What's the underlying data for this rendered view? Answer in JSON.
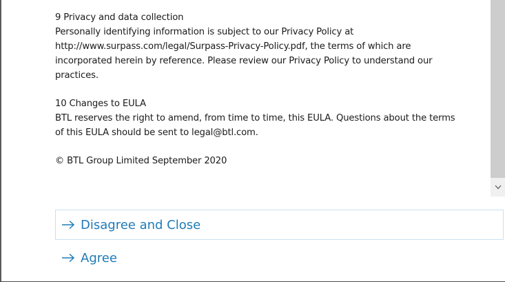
{
  "eula": {
    "lines": [
      "9 Privacy and data collection",
      "Personally identifying information is subject to our Privacy Policy at",
      "http://www.surpass.com/legal/Surpass-Privacy-Policy.pdf, the terms of which are",
      "incorporated herein by reference. Please review our Privacy Policy to understand our",
      "practices.",
      "10 Changes to EULA",
      "BTL reserves the right to amend, from time to time, this EULA. Questions about the terms",
      "of this EULA should be sent to legal@btl.com.",
      "© BTL Group Limited September 2020"
    ]
  },
  "scrollbar": {
    "down_icon": "chevron-down-icon"
  },
  "actions": {
    "disagree_label": "Disagree and Close",
    "agree_label": "Agree",
    "arrow_icon": "arrow-right-icon"
  },
  "colors": {
    "link": "#1f7ab8",
    "button_border": "#c9dff0",
    "scroll_thumb": "#cdcdcd",
    "text": "#1a1a1a"
  }
}
